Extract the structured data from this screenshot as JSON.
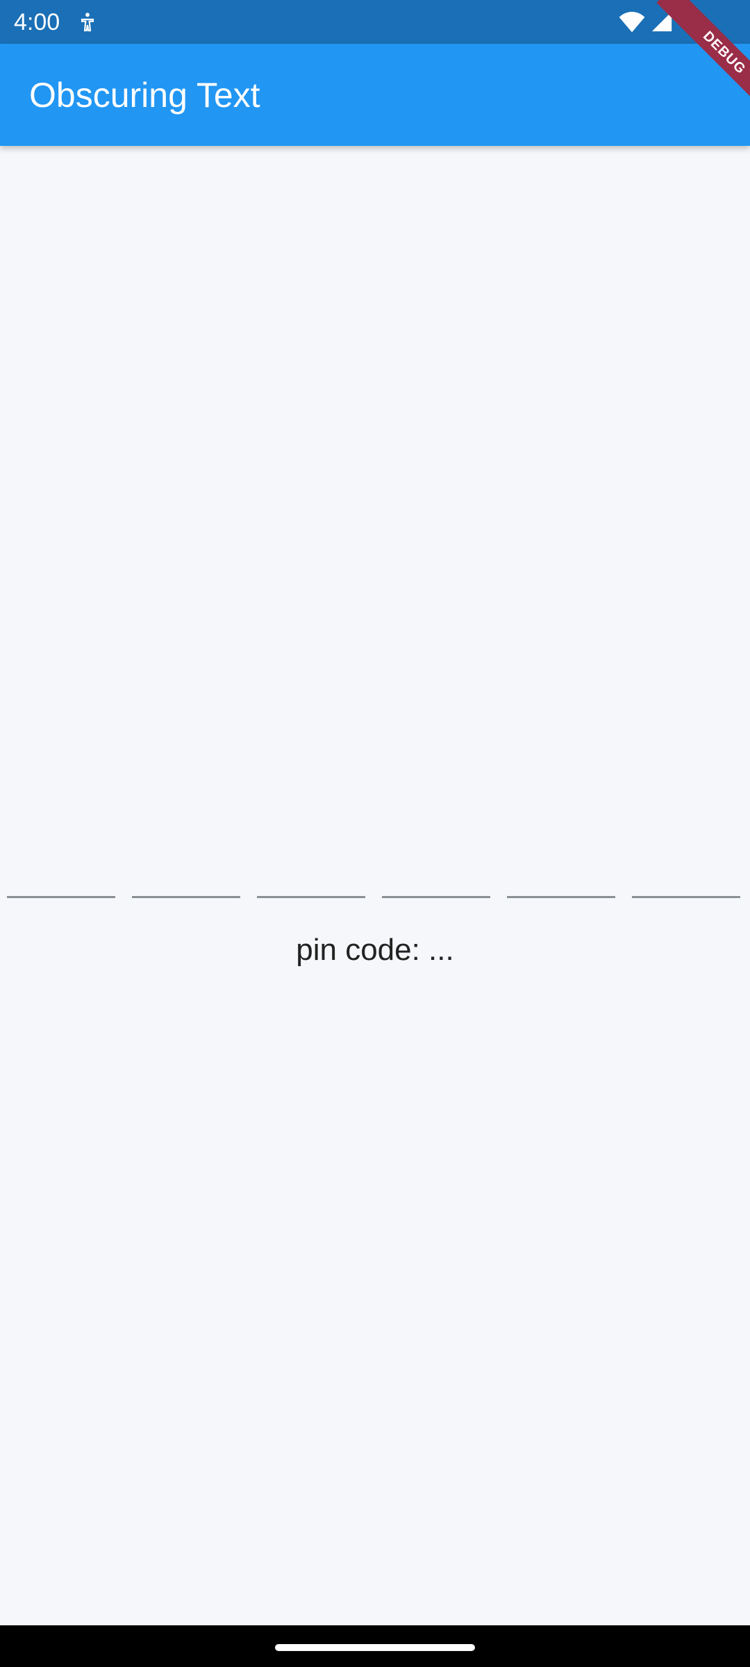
{
  "status_bar": {
    "time": "4:00",
    "notification_icon": "accessibility-notification-icon",
    "wifi_icon": "wifi-icon",
    "signal_icon": "cell-signal-icon",
    "background": "#1a6fb6"
  },
  "app_bar": {
    "title": "Obscuring Text",
    "background": "#2196f3",
    "debug_banner": "DEBUG"
  },
  "pin_input": {
    "fields": [
      "",
      "",
      "",
      "",
      "",
      ""
    ]
  },
  "pin_display": {
    "text": "pin code: ..."
  },
  "nav_bar": {
    "handle_icon": "gesture-handle"
  }
}
